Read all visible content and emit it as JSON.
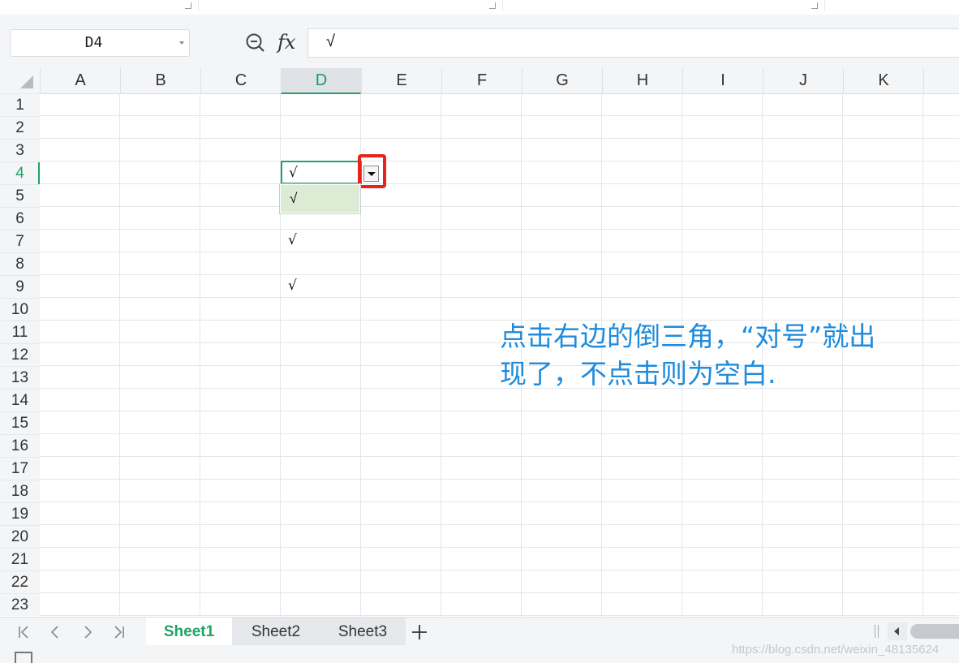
{
  "name_box": {
    "value": "D4"
  },
  "formula_bar": {
    "fx_label": "fx",
    "value": "√"
  },
  "columns": [
    "A",
    "B",
    "C",
    "D",
    "E",
    "F",
    "G",
    "H",
    "I",
    "J",
    "K"
  ],
  "rows": [
    "1",
    "2",
    "3",
    "4",
    "5",
    "6",
    "7",
    "8",
    "9",
    "10",
    "11",
    "12",
    "13",
    "14",
    "15",
    "16",
    "17",
    "18",
    "19",
    "20",
    "21",
    "22",
    "23"
  ],
  "active_cell": {
    "column": "D",
    "row": "4",
    "value": "√"
  },
  "cells": {
    "D7": "√",
    "D9": "√"
  },
  "dropdown": {
    "items": [
      "√"
    ]
  },
  "annotation": {
    "line1": "点击右边的倒三角，“对号”就出",
    "line2": "现了，不点击则为空白."
  },
  "sheets": {
    "nav": [
      "|<",
      "<",
      ">",
      ">|"
    ],
    "tabs": [
      "Sheet1",
      "Sheet2",
      "Sheet3"
    ],
    "active": "Sheet1",
    "add_label": "+"
  },
  "watermark": "https://blog.csdn.net/weixin_48135624",
  "colors": {
    "accent_green": "#21a366",
    "highlight_red": "#e8231c",
    "annotation_blue": "#1e8bdc",
    "dropdown_selected": "#dcebd3"
  }
}
